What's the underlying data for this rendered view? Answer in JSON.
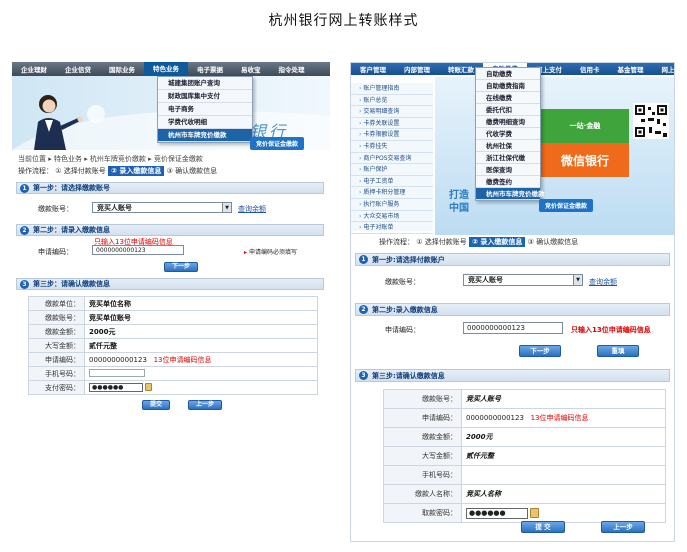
{
  "page_title": "杭州银行网上转账样式",
  "left": {
    "nav": [
      "企业理财",
      "企业信贷",
      "国际业务",
      "特色业务",
      "电子票据",
      "易收宝",
      "指令处理"
    ],
    "dropdown": [
      "城建集团账户查询",
      "财政国库集中支付",
      "电子商务",
      "学费代收明细",
      "杭州市车牌竞价缴款",
      "竞价保证金缴款"
    ],
    "banner_text": "网上银行",
    "breadcrumb": "当前位置 ▸ 特色业务 ▸ 杭州车牌竞价缴款 ▸ 竞价保证金缴款",
    "process": [
      "操作流程：",
      "① 选择付款账号",
      "② 录入缴款信息",
      "③ 确认缴款信息"
    ],
    "step1": {
      "title": "第一步：请选择缴款账号",
      "label": "缴款账号：",
      "value": "竞买人账号",
      "link": "查询余额"
    },
    "step2": {
      "title": "第二步：请录入缴款信息",
      "label": "申请编码：",
      "hint": "只输入13位申请编码信息",
      "value": "0000000000123",
      "right_hint": "申请编码必须填写",
      "button": "下一步"
    },
    "step3": {
      "title": "第三步：请确认缴款信息",
      "rows": [
        {
          "k": "缴款单位：",
          "v": "竞买单位名称"
        },
        {
          "k": "缴款账号：",
          "v": "竞买单位账号"
        },
        {
          "k": "缴款金额：",
          "v": "2000元"
        },
        {
          "k": "大写金额：",
          "v": "贰仟元整"
        },
        {
          "k": "申请编码：",
          "v": "0000000000123",
          "note": "13位申请编码信息"
        },
        {
          "k": "手机号码：",
          "v": ""
        },
        {
          "k": "支付密码：",
          "v": "●●●●●●"
        }
      ],
      "submit": "提交",
      "back": "上一步"
    }
  },
  "right": {
    "nav": [
      "客户管理",
      "内部管理",
      "转账汇款",
      "自助缴费",
      "网上支付",
      "信用卡",
      "基金管理",
      "网上基金"
    ],
    "sidebar": [
      "账户管理指南",
      "账户总览",
      "交易明细查询",
      "卡券关联设置",
      "卡券限额设置",
      "卡券挂失",
      "商户POS交易查询",
      "账户保护",
      "电子工资单",
      "质押卡积分管理",
      "执行账户服务",
      "大众交易市场",
      "电子对账单"
    ],
    "dropdown": [
      "自助缴费",
      "自助缴费指南",
      "在线缴费",
      "委托代扣",
      "缴费明细查询",
      "代收学费",
      "杭州社保",
      "浙江社保代缴",
      "医保查询",
      "缴费签约",
      "杭州市车牌竞价缴款",
      "竞价保证金缴款"
    ],
    "tile_green": "一站·金融",
    "tile_red": "微信银行",
    "banner_text": "打造中国",
    "process": [
      "操作流程：",
      "① 选择付款账号",
      "② 录入缴款信息",
      "③ 确认缴款信息"
    ],
    "step1": {
      "title": "第一步:请选择付款账户",
      "label": "缴款账号：",
      "value": "竞买人账号",
      "link": "查询余额"
    },
    "step2": {
      "title": "第二步:录入缴款信息",
      "label": "申请编码：",
      "value": "0000000000123",
      "hint": "只输入13位申请编码信息",
      "next": "下一步",
      "reset": "重填"
    },
    "step3": {
      "title": "第三步:请确认缴款信息",
      "rows": [
        {
          "k": "缴款账号：",
          "v": "竞买人账号"
        },
        {
          "k": "申请编码：",
          "v": "0000000000123",
          "note": "13位申请编码信息"
        },
        {
          "k": "缴款金额：",
          "v": "2000元"
        },
        {
          "k": "大写金额：",
          "v": "贰仟元整"
        },
        {
          "k": "手机号码：",
          "v": ""
        },
        {
          "k": "缴款人名称：",
          "v": "竞买人名称"
        },
        {
          "k": "取款密码：",
          "v": "●●●●●●"
        }
      ],
      "submit": "提 交",
      "back": "上一步"
    }
  },
  "colors": {
    "accent": "#1d63b5",
    "hint_red": "#e00000",
    "nav_dark": "#3e4a57",
    "nav_blue": "#164f92"
  }
}
